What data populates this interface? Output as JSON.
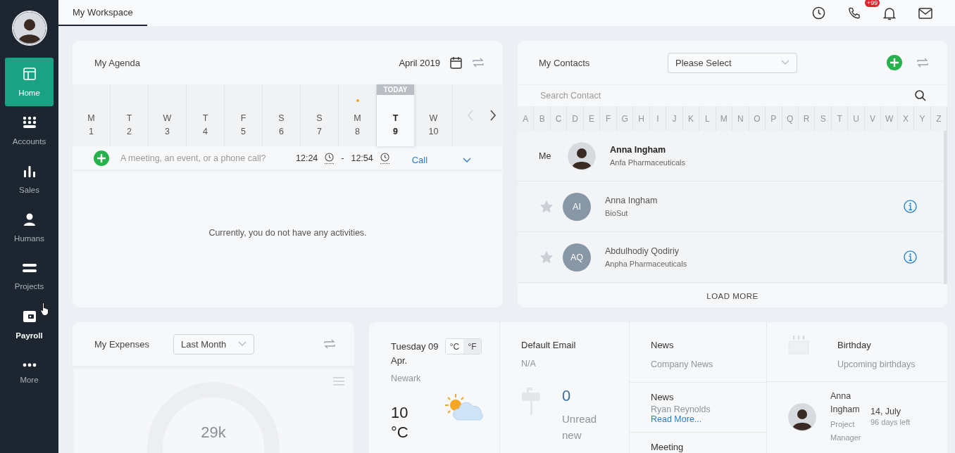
{
  "sidebar": {
    "items": [
      {
        "label": "Home",
        "selected": true,
        "hovered": false
      },
      {
        "label": "Accounts",
        "selected": false,
        "hovered": false
      },
      {
        "label": "Sales",
        "selected": false,
        "hovered": false
      },
      {
        "label": "Humans",
        "selected": false,
        "hovered": false
      },
      {
        "label": "Projects",
        "selected": false,
        "hovered": false
      },
      {
        "label": "Payroll",
        "selected": false,
        "hovered": true
      },
      {
        "label": "More",
        "selected": false,
        "hovered": false
      }
    ]
  },
  "tabs": [
    {
      "label": "My Workspace",
      "selected": true
    }
  ],
  "notification_badge": "+99",
  "agenda": {
    "title": "My Agenda",
    "month": "April 2019",
    "today_label": "TODAY",
    "days": [
      {
        "weekday": "M",
        "day": "1",
        "selected": false,
        "has_event": false
      },
      {
        "weekday": "T",
        "day": "2",
        "selected": false,
        "has_event": false
      },
      {
        "weekday": "W",
        "day": "3",
        "selected": false,
        "has_event": false
      },
      {
        "weekday": "T",
        "day": "4",
        "selected": false,
        "has_event": false
      },
      {
        "weekday": "F",
        "day": "5",
        "selected": false,
        "has_event": false
      },
      {
        "weekday": "S",
        "day": "6",
        "selected": false,
        "has_event": false
      },
      {
        "weekday": "S",
        "day": "7",
        "selected": false,
        "has_event": false
      },
      {
        "weekday": "M",
        "day": "8",
        "selected": false,
        "has_event": true
      },
      {
        "weekday": "T",
        "day": "9",
        "selected": true,
        "has_event": false
      },
      {
        "weekday": "W",
        "day": "10",
        "selected": false,
        "has_event": false
      }
    ],
    "new_activity": {
      "placeholder": "A meeting, an event, or a phone call?",
      "start": "12:24",
      "separator": "-",
      "end": "12:54",
      "type": "Call"
    },
    "empty_message": "Currently, you do not have any activities."
  },
  "contacts": {
    "title": "My Contacts",
    "filter_placeholder": "Please Select",
    "search_placeholder": "Search Contact",
    "letters": [
      "A",
      "B",
      "C",
      "D",
      "E",
      "F",
      "G",
      "H",
      "I",
      "J",
      "K",
      "L",
      "M",
      "N",
      "O",
      "P",
      "Q",
      "R",
      "S",
      "T",
      "U",
      "V",
      "W",
      "X",
      "Y",
      "Z"
    ],
    "me": {
      "label": "Me",
      "name": "Anna Ingham",
      "company": "Anfa Pharmaceuticals"
    },
    "people": [
      {
        "initials": "AI",
        "name": "Anna Ingham",
        "company": "BioSut",
        "starred": false
      },
      {
        "initials": "AQ",
        "name": "Abdulhodiy Qodiriy",
        "company": "Anpha Pharmaceuticals",
        "starred": false
      }
    ],
    "load_more": "LOAD MORE"
  },
  "expenses": {
    "title": "My Expenses",
    "period": "Last Month",
    "chart_center": "29k"
  },
  "weather": {
    "date": "Tuesday 09 Apr.",
    "units": [
      {
        "label": "°C",
        "selected": false
      },
      {
        "label": "°F",
        "selected": true
      }
    ],
    "city": "Newark",
    "temperature": "10",
    "temperature_unit": "°C"
  },
  "email": {
    "title": "Default Email",
    "address": "N/A",
    "count": "0",
    "count_label": "Unread new"
  },
  "news": {
    "title": "News",
    "subtitle": "Company News",
    "items": [
      {
        "title": "News",
        "text": "Ryan Reynolds",
        "link": "Read More..."
      },
      {
        "title": "Meeting"
      }
    ]
  },
  "birthday": {
    "title": "Birthday",
    "subtitle": "Upcoming birthdays",
    "people": [
      {
        "name": "Anna Ingham",
        "date": "14, July",
        "role": "Project Manager",
        "remaining": "96 days left"
      }
    ]
  }
}
